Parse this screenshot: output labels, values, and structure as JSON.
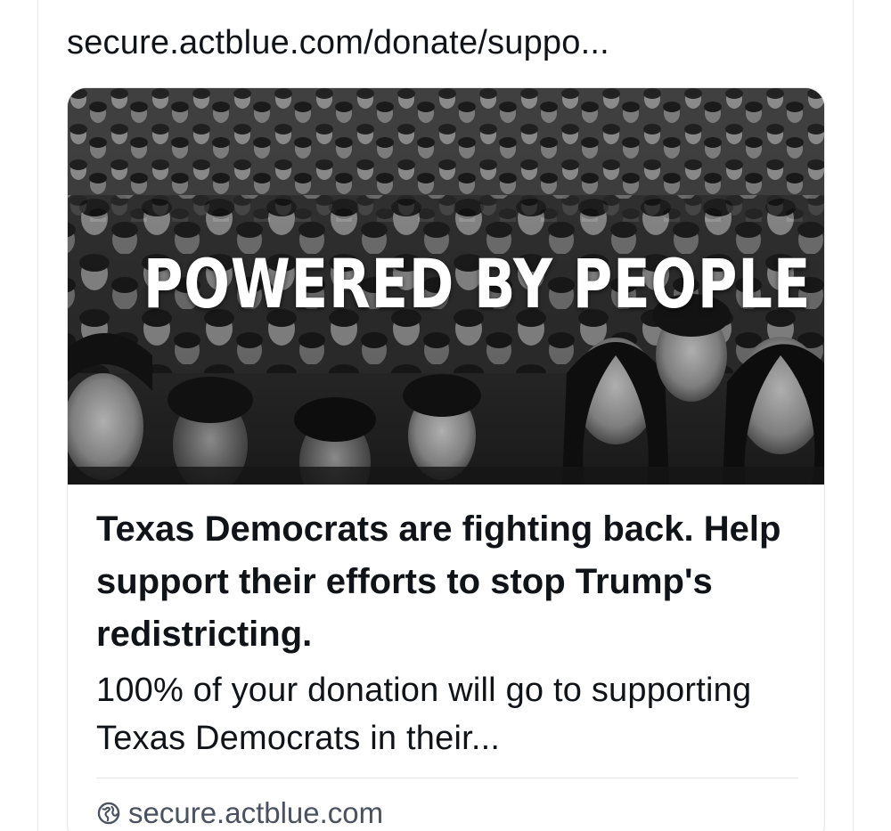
{
  "post": {
    "link_text": "secure.actblue.com/donate/suppo..."
  },
  "link_card": {
    "image": {
      "overlay_text": "POWERED BY PEOPLE",
      "icon": "crowd-photo"
    },
    "title": "Texas Democrats are fighting back. Help support their efforts to stop Trump's redistricting.",
    "description": "100% of your donation will go to supporting Texas Democrats in their...",
    "domain": "secure.actblue.com",
    "domain_icon": "globe-icon"
  },
  "colors": {
    "text_primary": "#101418",
    "text_secondary": "#4a5260",
    "border": "#e3e5e8"
  }
}
